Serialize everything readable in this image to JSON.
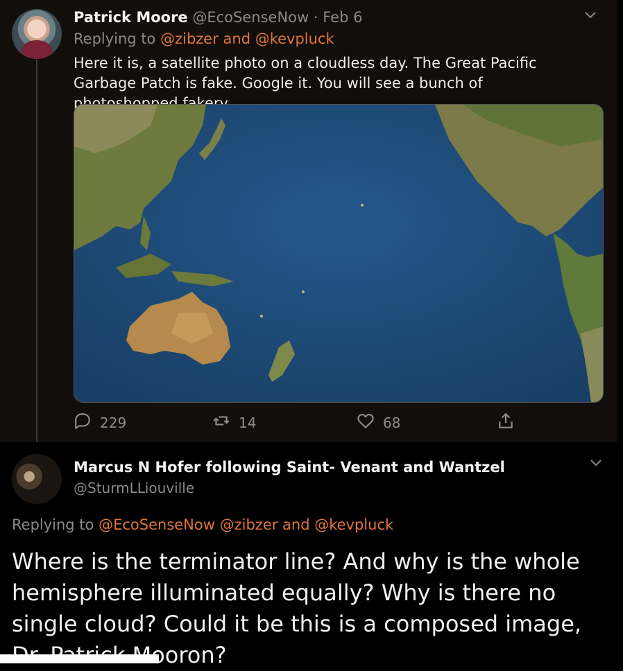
{
  "tweet1": {
    "name": "Patrick Moore",
    "handle": "@EcoSenseNow",
    "separator": "·",
    "date": "Feb 6",
    "replying_prefix": "Replying to",
    "replying_mentions": "@zibzer and @kevpluck",
    "text": "Here it is, a satellite photo on a cloudless day. The Great Pacific Garbage Patch is fake. Google it. You will see a bunch of photoshopped fakery.",
    "reply_count": "229",
    "retweet_count": "14",
    "like_count": "68"
  },
  "tweet2": {
    "name": "Marcus N Hofer following Saint- Venant and Wantzel",
    "handle": "@SturmLLiouville",
    "replying_prefix": "Replying to",
    "replying_mentions": "@EcoSenseNow @zibzer and @kevpluck",
    "text": "Where is the terminator line? And why is the whole hemisphere illuminated equally? Why is there no single cloud? Could it be this is a composed image, Dr. Patrick Mooron?"
  },
  "colors": {
    "accent": "#e0753c",
    "background": "#110e0c",
    "muted": "#8a8a8a"
  }
}
